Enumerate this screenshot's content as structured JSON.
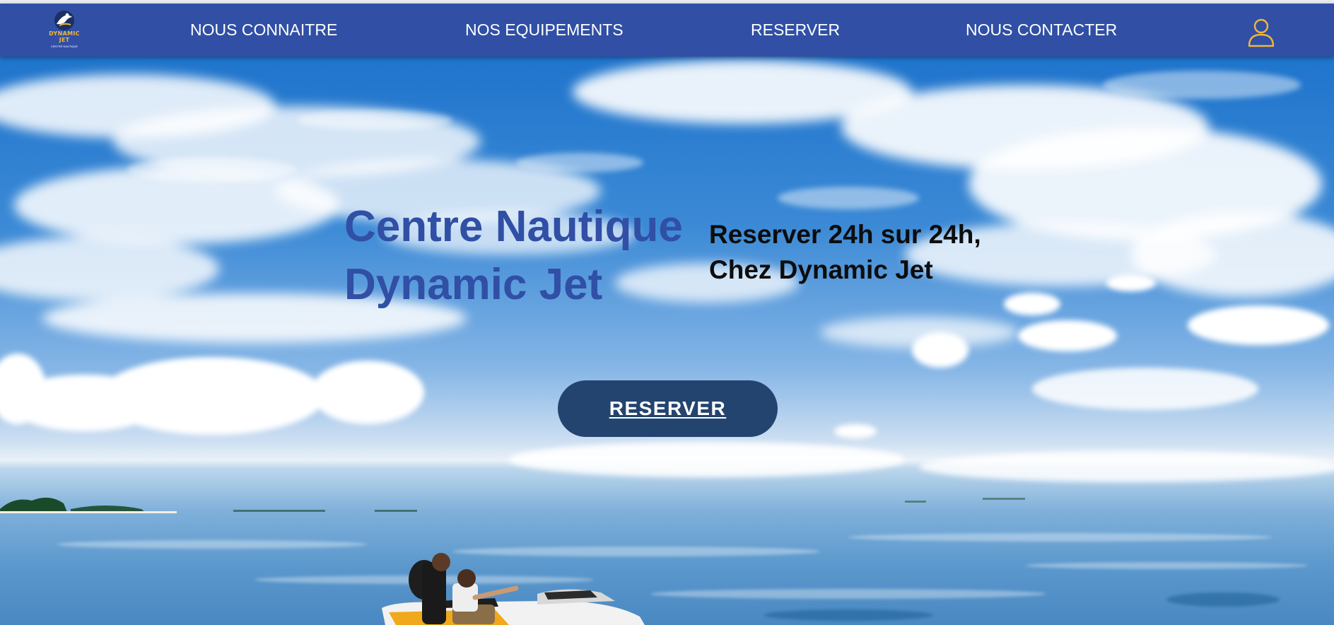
{
  "logo": {
    "brand": "DYNAMIC JET",
    "line1": "DYNAMIC",
    "line2": "JET",
    "subtitle": "CENTRE NAUTIQUE",
    "icon": "jetski-rider-logo-icon"
  },
  "nav": {
    "items": [
      {
        "label": "NOUS CONNAITRE"
      },
      {
        "label": "NOS EQUIPEMENTS"
      },
      {
        "label": "RESERVER"
      },
      {
        "label": "NOUS CONTACTER"
      }
    ],
    "account_icon": "user-icon"
  },
  "hero": {
    "title_line1": "Centre Nautique",
    "title_line2": "Dynamic Jet",
    "tagline_line1": "Reserver 24h sur 24h,",
    "tagline_line2": "Chez Dynamic Jet",
    "cta_label": "RESERVER"
  },
  "colors": {
    "navbar": "#304fa5",
    "title": "#304fa5",
    "cta_background": "#23446f",
    "logo_accent": "#f2b63a",
    "user_icon": "#f2b63a"
  }
}
